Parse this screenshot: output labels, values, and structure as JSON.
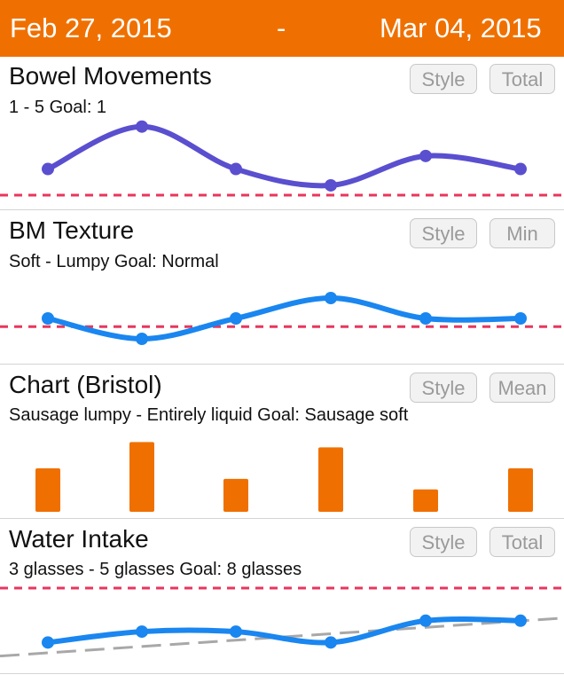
{
  "header": {
    "start_date": "Feb 27, 2015",
    "separator": "-",
    "end_date": "Mar 04, 2015"
  },
  "colors": {
    "header": "#ef7000",
    "bowel_line": "#5a4fcf",
    "blue_line": "#1a86f0",
    "bar": "#ef7000",
    "goal": "#e8365d",
    "trend": "#a8a8a8"
  },
  "sections": [
    {
      "title": "Bowel Movements",
      "subtitle": "1  - 5  Goal: 1",
      "style_label": "Style",
      "agg_label": "Total"
    },
    {
      "title": "BM Texture",
      "subtitle": "Soft - Lumpy Goal: Normal",
      "style_label": "Style",
      "agg_label": "Min"
    },
    {
      "title": "Chart (Bristol)",
      "subtitle": "Sausage lumpy - Entirely liquid Goal: Sausage soft",
      "style_label": "Style",
      "agg_label": "Mean"
    },
    {
      "title": "Water Intake",
      "subtitle": "3 glasses - 5 glasses Goal: 8 glasses",
      "style_label": "Style",
      "agg_label": "Total"
    }
  ],
  "chart_data": [
    {
      "type": "line",
      "x": [
        1,
        2,
        3,
        4,
        5,
        6
      ],
      "values": [
        1.6,
        4.2,
        1.6,
        0.6,
        2.4,
        1.6
      ],
      "ylim": [
        0,
        5
      ],
      "goal": 0
    },
    {
      "type": "line",
      "x": [
        1,
        2,
        3,
        4,
        5,
        6
      ],
      "values": [
        2.0,
        1.0,
        2.0,
        3.0,
        2.0,
        2.0
      ],
      "ylim": [
        0,
        4
      ],
      "goal": 1.6
    },
    {
      "type": "bar",
      "x": [
        1,
        2,
        3,
        4,
        5,
        6
      ],
      "values": [
        3.3,
        5.3,
        2.5,
        4.9,
        1.7,
        3.3
      ],
      "ylim": [
        0,
        6
      ]
    },
    {
      "type": "line",
      "x": [
        1,
        2,
        3,
        4,
        5,
        6
      ],
      "values": [
        4.0,
        4.4,
        4.4,
        4.0,
        4.8,
        4.8
      ],
      "ylim": [
        3,
        6
      ],
      "goal": 6.0,
      "trend": [
        3.5,
        4.9
      ]
    }
  ]
}
